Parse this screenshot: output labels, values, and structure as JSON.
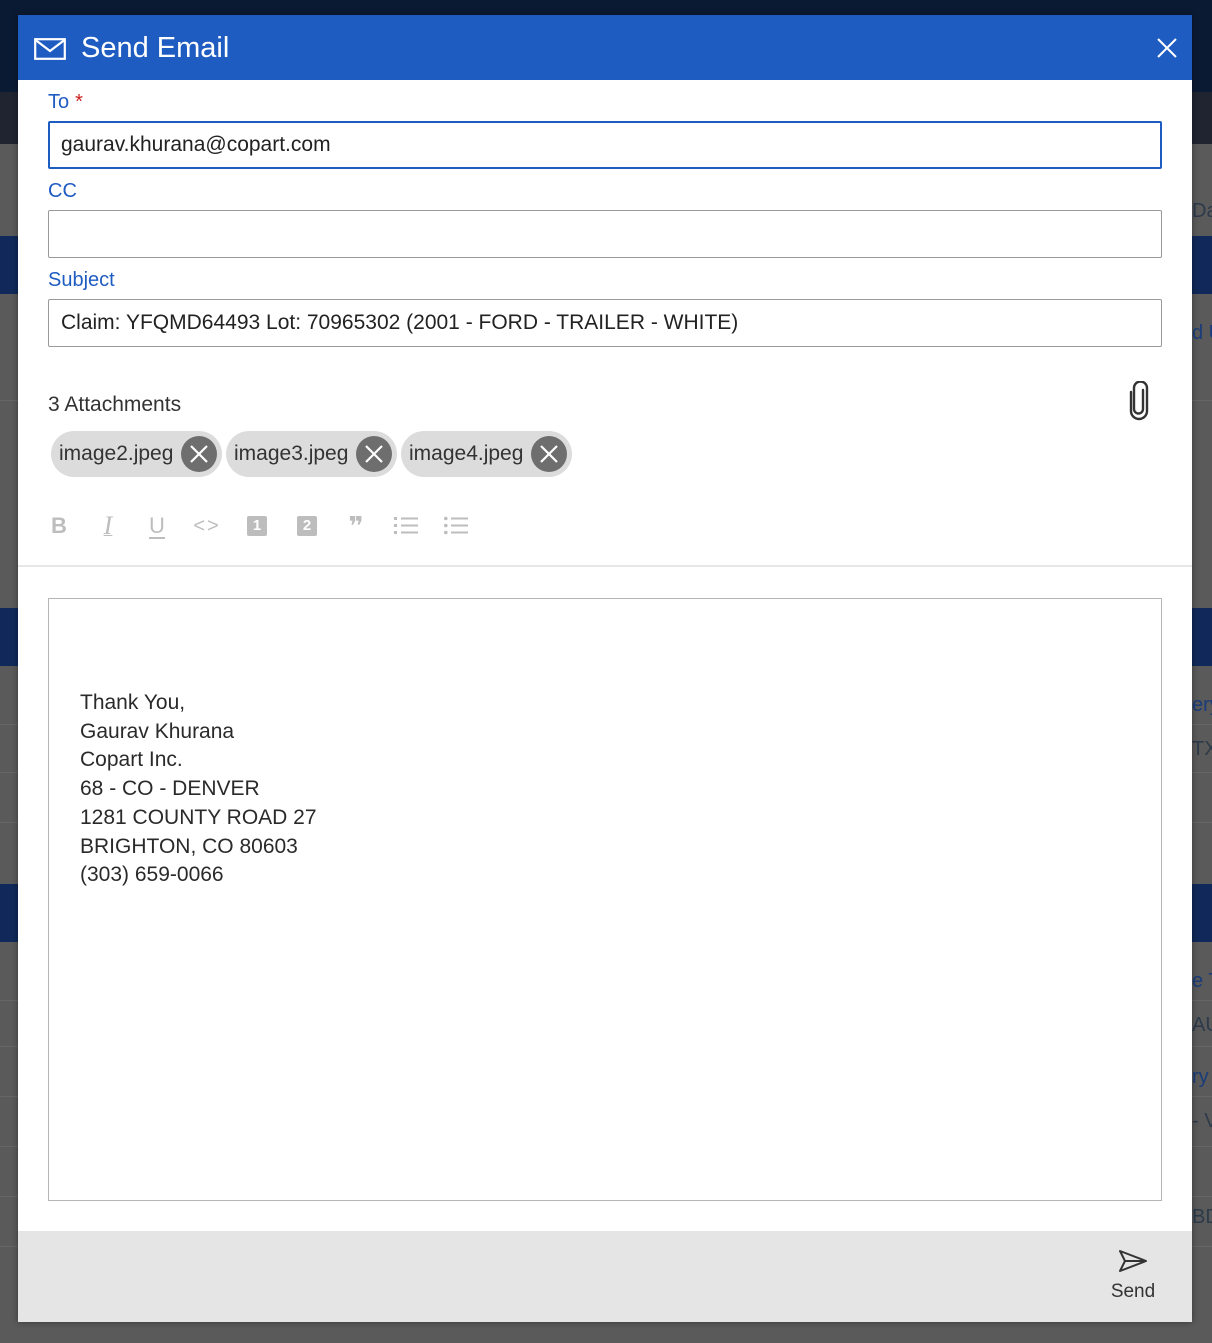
{
  "modal": {
    "title": "Send Email",
    "icons": {
      "header": "mail-icon",
      "close": "close-icon"
    }
  },
  "form": {
    "to": {
      "label": "To",
      "required_mark": "*",
      "value": "gaurav.khurana@copart.com"
    },
    "cc": {
      "label": "CC",
      "value": ""
    },
    "subject": {
      "label": "Subject",
      "value": "Claim: YFQMD64493 Lot: 70965302 (2001 - FORD - TRAILER - WHITE)"
    }
  },
  "attachments": {
    "count_label": "3 Attachments",
    "icon": "paperclip-icon",
    "files": [
      "image2.jpeg",
      "image3.jpeg",
      "image4.jpeg"
    ]
  },
  "toolbar": {
    "buttons": [
      "bold",
      "italic",
      "underline",
      "code",
      "heading-one",
      "heading-two",
      "block-quote",
      "numbered-list",
      "bulleted-list"
    ],
    "glyphs": {
      "bold": "B",
      "italic": "I",
      "underline": "U",
      "code": "<>",
      "heading_one": "1",
      "heading_two": "2",
      "quote": "❞"
    }
  },
  "editor": {
    "signature": [
      "Thank You,",
      "Gaurav Khurana",
      "Copart Inc.",
      "68 - CO - DENVER",
      "1281 COUNTY ROAD 27",
      "BRIGHTON, CO 80603",
      "(303) 659-0066"
    ]
  },
  "footer": {
    "send_label": "Send",
    "send_icon": "send-icon"
  },
  "background": {
    "peek_fragments": [
      "Da",
      "d U",
      "ery",
      "TX",
      "e T",
      "AU",
      "ry",
      "- V",
      "BD"
    ]
  },
  "colors": {
    "header": "#1f5cc2",
    "label": "#1f5cc2",
    "required": "#cc1f1f",
    "chip": "#dcdcdc",
    "chip_remove": "#6e6e6e",
    "footer": "#e5e5e5",
    "toolbar_disabled": "#bdbdbd"
  }
}
